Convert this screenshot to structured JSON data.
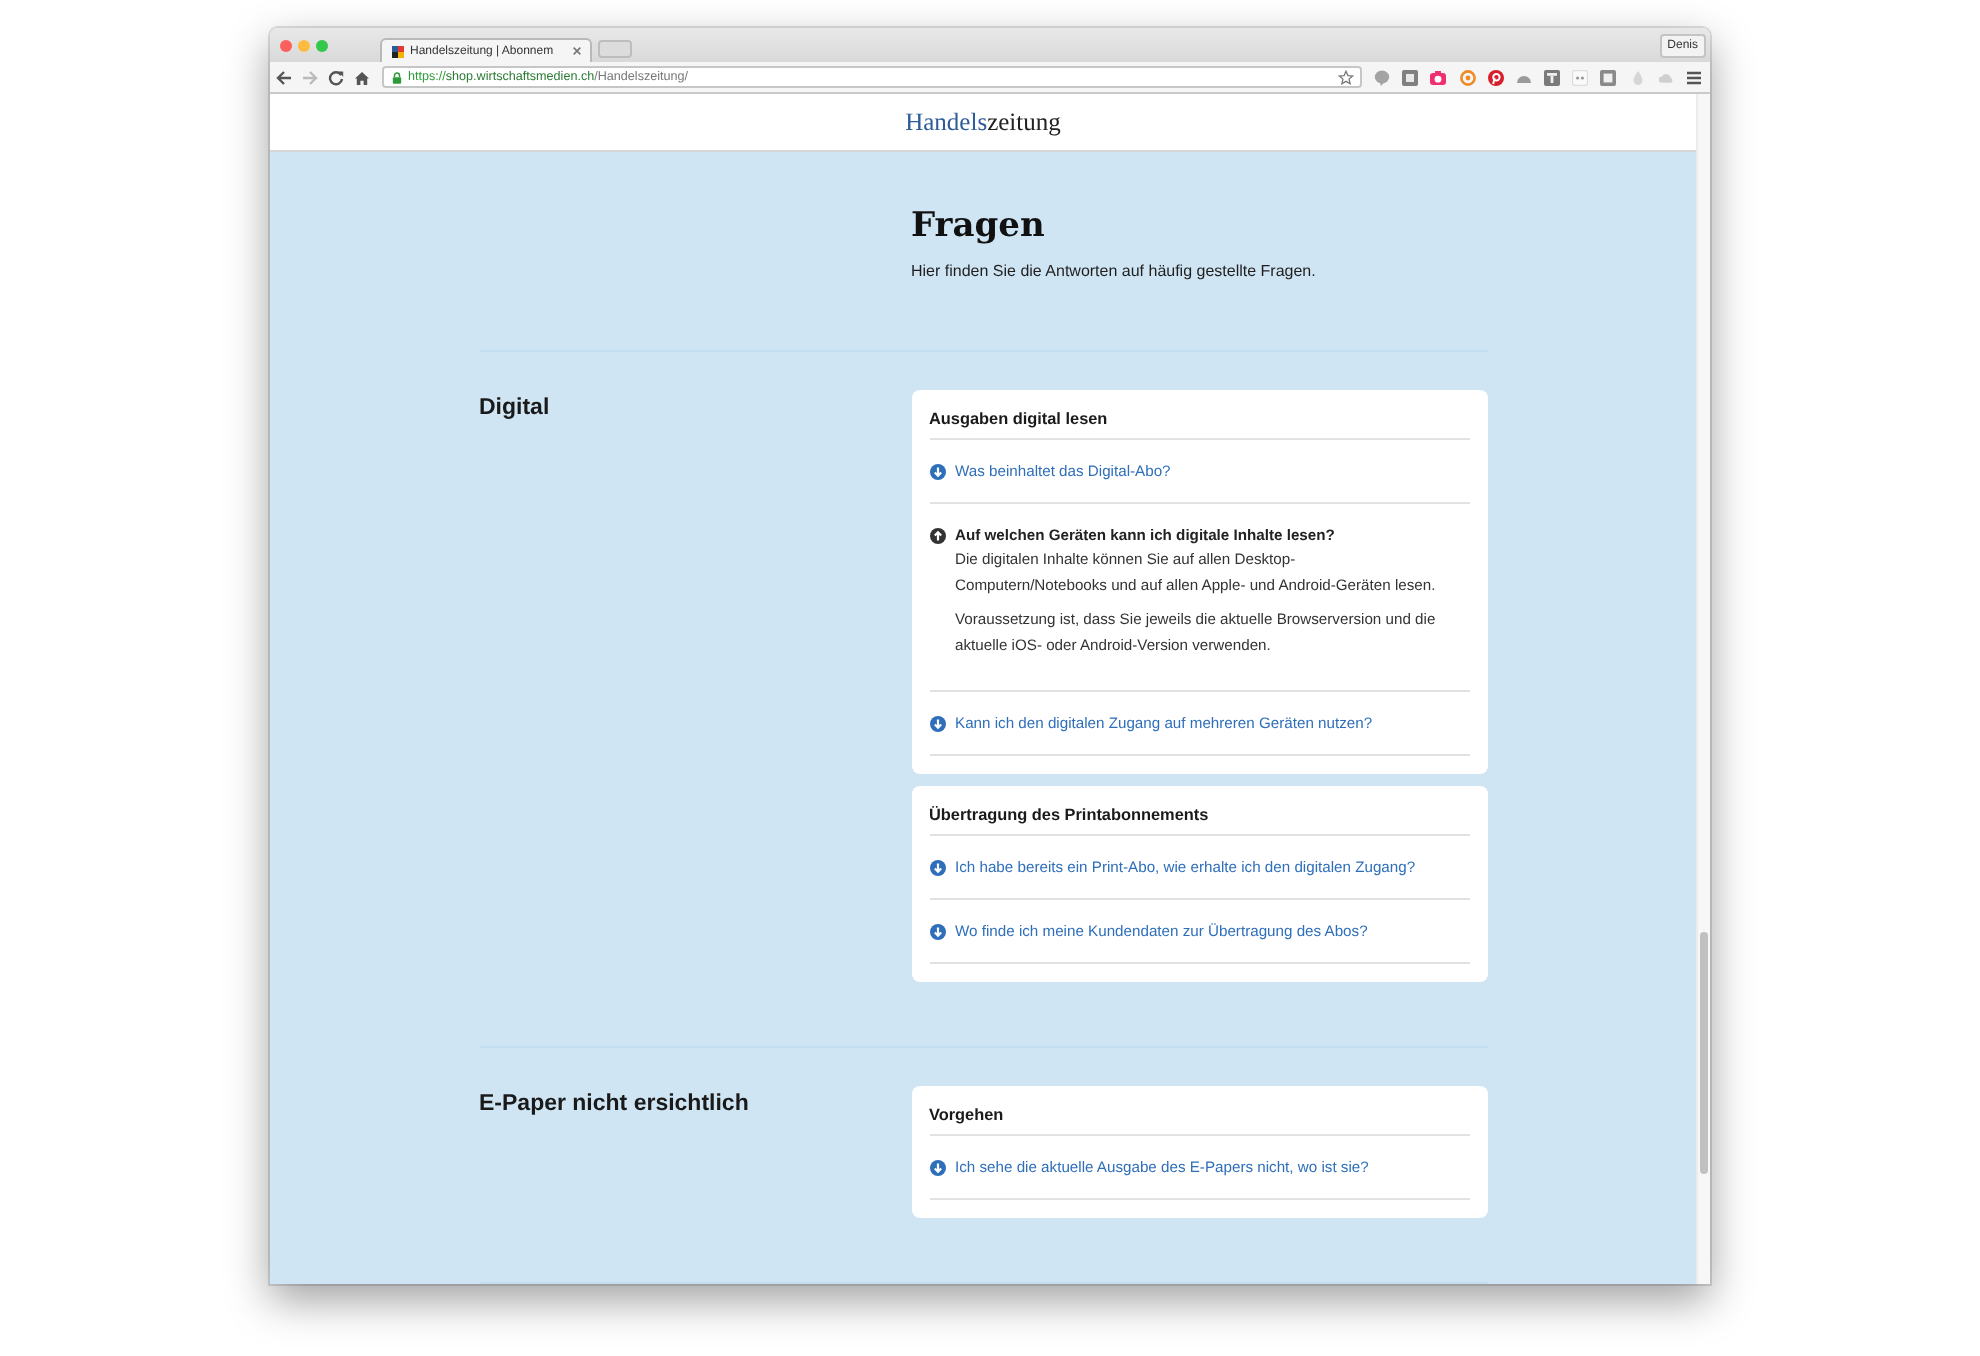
{
  "browser": {
    "tabs": [
      {
        "title": "Handelszeitung | Abonnem",
        "selected": true
      }
    ],
    "profile": "Denis",
    "address": {
      "scheme": "https://",
      "host": "shop.wirtschaftsmedien.ch",
      "path": "/Handelszeitung/"
    }
  },
  "site_header": {
    "logo": {
      "lead": "Handels",
      "tail": "zeitung"
    }
  },
  "intro": {
    "title": "Fragen",
    "subtitle": "Hier finden Sie die Antworten auf häufig gestellte Fragen."
  },
  "sections": [
    {
      "heading": "Digital",
      "groups": [
        {
          "title": "Ausgaben digital lesen",
          "questions": [
            {
              "question": "Was beinhaltet das Digital-Abo?",
              "expanded": false
            },
            {
              "question": "Auf welchen Geräten kann ich digitale Inhalte lesen?",
              "expanded": true,
              "answer": [
                "Die digitalen Inhalte können Sie auf allen Desktop-Computern/Notebooks und auf allen Apple- und Android-Geräten lesen.",
                "Voraussetzung ist, dass Sie jeweils die aktuelle Browserversion und die aktuelle iOS- oder Android-Version verwenden."
              ]
            },
            {
              "question": "Kann ich den digitalen Zugang auf mehreren Geräten nutzen?",
              "expanded": false
            }
          ]
        },
        {
          "title": "Übertragung des Printabonnements",
          "questions": [
            {
              "question": "Ich habe bereits ein Print-Abo, wie erhalte ich den digitalen Zugang?",
              "expanded": false
            },
            {
              "question": "Wo finde ich meine Kundendaten zur Übertragung des Abos?",
              "expanded": false
            }
          ]
        }
      ]
    },
    {
      "heading": "E-Paper nicht ersichtlich",
      "groups": [
        {
          "title": "Vorgehen",
          "questions": [
            {
              "question": "Ich sehe die aktuelle Ausgabe des E-Papers nicht, wo ist sie?",
              "expanded": false
            }
          ]
        }
      ]
    }
  ]
}
